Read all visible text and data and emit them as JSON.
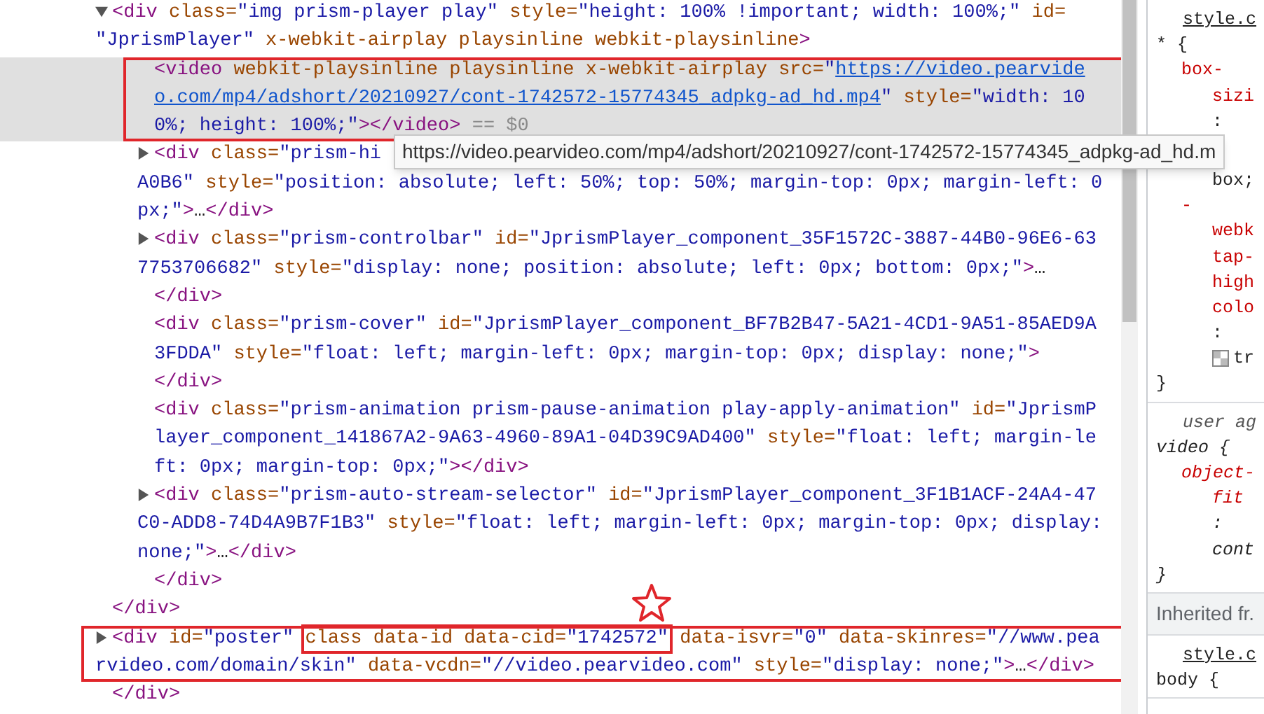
{
  "dom_tree": [
    {
      "kind": "element",
      "expandable": true,
      "expanded": true,
      "selected": false,
      "annotated": false,
      "lines": [
        [
          {
            "kind": "tag",
            "text": "<div"
          },
          {
            "kind": "attr",
            "text": " class="
          },
          {
            "kind": "value",
            "text": "\"img prism-player play\""
          },
          {
            "kind": "attr",
            "text": " style="
          },
          {
            "kind": "value",
            "text": "\"height: 100% !important; width: 100%;\""
          },
          {
            "kind": "attr",
            "text": " id="
          }
        ],
        [
          {
            "kind": "value",
            "text": "\"JprismPlayer\""
          },
          {
            "kind": "attr",
            "text": " x-webkit-airplay playsinline webkit-playsinline"
          },
          {
            "kind": "tag",
            "text": ">"
          }
        ]
      ],
      "children": [
        {
          "kind": "element",
          "expandable": false,
          "selected": true,
          "annotated": true,
          "lines": [
            [
              {
                "kind": "tag",
                "text": "<video"
              },
              {
                "kind": "attr",
                "text": " webkit-playsinline playsinline x-webkit-airplay src="
              },
              {
                "kind": "value",
                "text": "\""
              },
              {
                "kind": "link",
                "text": "https://video.pearvide"
              }
            ],
            [
              {
                "kind": "link",
                "text": "o.com/mp4/adshort/20210927/cont-1742572-15774345_adpkg-ad_hd.mp4"
              },
              {
                "kind": "value",
                "text": "\""
              },
              {
                "kind": "attr",
                "text": " style="
              },
              {
                "kind": "value",
                "text": "\"width: 10"
              }
            ],
            [
              {
                "kind": "value",
                "text": "0%; height: 100%;\""
              },
              {
                "kind": "tag",
                "text": "></video>"
              },
              {
                "kind": "dim",
                "text": " == $0"
              }
            ]
          ]
        },
        {
          "kind": "element",
          "expandable": true,
          "expanded": false,
          "selected": false,
          "annotated": false,
          "lines": [
            [
              {
                "kind": "tag",
                "text": "<div"
              },
              {
                "kind": "attr",
                "text": " class="
              },
              {
                "kind": "value",
                "text": "\"prism-hi"
              }
            ],
            [
              {
                "kind": "value",
                "text": "A0B6\""
              },
              {
                "kind": "attr",
                "text": " style="
              },
              {
                "kind": "value",
                "text": "\"position: absolute; left: 50%; top: 50%; margin-top: 0px; margin-left: 0"
              }
            ],
            [
              {
                "kind": "value",
                "text": "px;\""
              },
              {
                "kind": "tag",
                "text": ">"
              },
              {
                "kind": "text",
                "text": "…"
              },
              {
                "kind": "tag",
                "text": "</div>"
              }
            ]
          ]
        },
        {
          "kind": "element",
          "expandable": true,
          "expanded": false,
          "selected": false,
          "annotated": false,
          "lines": [
            [
              {
                "kind": "tag",
                "text": "<div"
              },
              {
                "kind": "attr",
                "text": " class="
              },
              {
                "kind": "value",
                "text": "\"prism-controlbar\""
              },
              {
                "kind": "attr",
                "text": " id="
              },
              {
                "kind": "value",
                "text": "\"JprismPlayer_component_35F1572C-3887-44B0-96E6-63"
              }
            ],
            [
              {
                "kind": "value",
                "text": "7753706682\""
              },
              {
                "kind": "attr",
                "text": " style="
              },
              {
                "kind": "value",
                "text": "\"display: none; position: absolute; left: 0px; bottom: 0px;\""
              },
              {
                "kind": "tag",
                "text": ">"
              },
              {
                "kind": "text",
                "text": "…"
              }
            ]
          ]
        },
        {
          "kind": "closing",
          "text": "</div>"
        },
        {
          "kind": "element",
          "expandable": false,
          "selected": false,
          "annotated": false,
          "lines": [
            [
              {
                "kind": "tag",
                "text": "<div"
              },
              {
                "kind": "attr",
                "text": " class="
              },
              {
                "kind": "value",
                "text": "\"prism-cover\""
              },
              {
                "kind": "attr",
                "text": " id="
              },
              {
                "kind": "value",
                "text": "\"JprismPlayer_component_BF7B2B47-5A21-4CD1-9A51-85AED9A"
              }
            ],
            [
              {
                "kind": "value",
                "text": "3FDDA\""
              },
              {
                "kind": "attr",
                "text": " style="
              },
              {
                "kind": "value",
                "text": "\"float: left; margin-left: 0px; margin-top: 0px; display: none;\""
              },
              {
                "kind": "tag",
                "text": ">"
              }
            ]
          ]
        },
        {
          "kind": "closing",
          "text": "</div>"
        },
        {
          "kind": "element",
          "expandable": false,
          "selected": false,
          "annotated": false,
          "lines": [
            [
              {
                "kind": "tag",
                "text": "<div"
              },
              {
                "kind": "attr",
                "text": " class="
              },
              {
                "kind": "value",
                "text": "\"prism-animation prism-pause-animation play-apply-animation\""
              },
              {
                "kind": "attr",
                "text": " id="
              },
              {
                "kind": "value",
                "text": "\"JprismP"
              }
            ],
            [
              {
                "kind": "value",
                "text": "layer_component_141867A2-9A63-4960-89A1-04D39C9AD400\""
              },
              {
                "kind": "attr",
                "text": " style="
              },
              {
                "kind": "value",
                "text": "\"float: left; margin-le"
              }
            ],
            [
              {
                "kind": "value",
                "text": "ft: 0px; margin-top: 0px;\""
              },
              {
                "kind": "tag",
                "text": "></div>"
              }
            ]
          ]
        },
        {
          "kind": "element",
          "expandable": true,
          "expanded": false,
          "selected": false,
          "annotated": false,
          "lines": [
            [
              {
                "kind": "tag",
                "text": "<div"
              },
              {
                "kind": "attr",
                "text": " class="
              },
              {
                "kind": "value",
                "text": "\"prism-auto-stream-selector\""
              },
              {
                "kind": "attr",
                "text": " id="
              },
              {
                "kind": "value",
                "text": "\"JprismPlayer_component_3F1B1ACF-24A4-47"
              }
            ],
            [
              {
                "kind": "value",
                "text": "C0-ADD8-74D4A9B7F1B3\""
              },
              {
                "kind": "attr",
                "text": " style="
              },
              {
                "kind": "value",
                "text": "\"float: left; margin-left: 0px; margin-top: 0px; display:"
              }
            ],
            [
              {
                "kind": "value",
                "text": "none;\""
              },
              {
                "kind": "tag",
                "text": ">"
              },
              {
                "kind": "text",
                "text": "…"
              },
              {
                "kind": "tag",
                "text": "</div>"
              }
            ]
          ]
        },
        {
          "kind": "closing",
          "text": "</div>"
        }
      ]
    },
    {
      "kind": "closing",
      "text": "</div>"
    },
    {
      "kind": "element",
      "expandable": true,
      "expanded": false,
      "selected": false,
      "annotated": true,
      "lines": [
        [
          {
            "kind": "tag",
            "text": "<div"
          },
          {
            "kind": "attr",
            "text": " id="
          },
          {
            "kind": "value",
            "text": "\"poster\" "
          },
          {
            "kind": "box",
            "annotated": true,
            "starred": true,
            "tokens": [
              {
                "kind": "attr",
                "text": "class data-id data-cid="
              },
              {
                "kind": "value",
                "text": "\"1742572\""
              }
            ]
          },
          {
            "kind": "attr",
            "text": " data-isvr="
          },
          {
            "kind": "value",
            "text": "\"0\""
          },
          {
            "kind": "attr",
            "text": " data-skinres="
          },
          {
            "kind": "value",
            "text": "\"//www.pea"
          }
        ],
        [
          {
            "kind": "value",
            "text": "rvideo.com/domain/skin\""
          },
          {
            "kind": "attr",
            "text": " data-vcdn="
          },
          {
            "kind": "value",
            "text": "\"//video.pearvideo.com\""
          },
          {
            "kind": "attr",
            "text": " style="
          },
          {
            "kind": "value",
            "text": "\"display: none;\""
          },
          {
            "kind": "tag",
            "text": ">"
          },
          {
            "kind": "text",
            "text": "…"
          },
          {
            "kind": "tag",
            "text": "</div>"
          }
        ]
      ]
    },
    {
      "kind": "closing",
      "text": "</div>"
    }
  ],
  "tooltip": "https://video.pearvideo.com/mp4/adshort/20210927/cont-1742572-15774345_adpkg-ad_hd.m",
  "styles": [
    {
      "kind": "rule",
      "user_agent": false,
      "lines": [
        {
          "kind": "source",
          "text": "style.c"
        },
        {
          "kind": "selector",
          "text": "* {"
        },
        {
          "kind": "prop",
          "text": "box-"
        },
        {
          "kind": "prop_cont",
          "text": "sizi"
        },
        {
          "kind": "colon",
          "text": ":"
        },
        {
          "kind": "value",
          "text": "box;",
          "covered_above": true
        },
        {
          "kind": "prop",
          "text": "-"
        },
        {
          "kind": "prop_cont",
          "text": "webk"
        },
        {
          "kind": "prop_cont",
          "text": "tap-"
        },
        {
          "kind": "prop_cont",
          "text": "high"
        },
        {
          "kind": "prop_cont",
          "text": "colo"
        },
        {
          "kind": "colon",
          "text": ":"
        },
        {
          "kind": "swatch",
          "text": "tr"
        },
        {
          "kind": "selector",
          "text": "}"
        }
      ]
    },
    {
      "kind": "rule",
      "user_agent": true,
      "lines": [
        {
          "kind": "source",
          "text": "user ag"
        },
        {
          "kind": "selector",
          "text": "video {"
        },
        {
          "kind": "prop",
          "text": "object-"
        },
        {
          "kind": "prop_cont",
          "text": "fit"
        },
        {
          "kind": "colon",
          "text": ":"
        },
        {
          "kind": "value",
          "text": "cont",
          "covered_above": false
        },
        {
          "kind": "selector",
          "text": "}"
        }
      ]
    },
    {
      "kind": "header",
      "text": "Inherited fr."
    },
    {
      "kind": "rule",
      "user_agent": false,
      "lines": [
        {
          "kind": "source",
          "text": "style.c"
        },
        {
          "kind": "selector",
          "text": "body {"
        }
      ]
    }
  ]
}
